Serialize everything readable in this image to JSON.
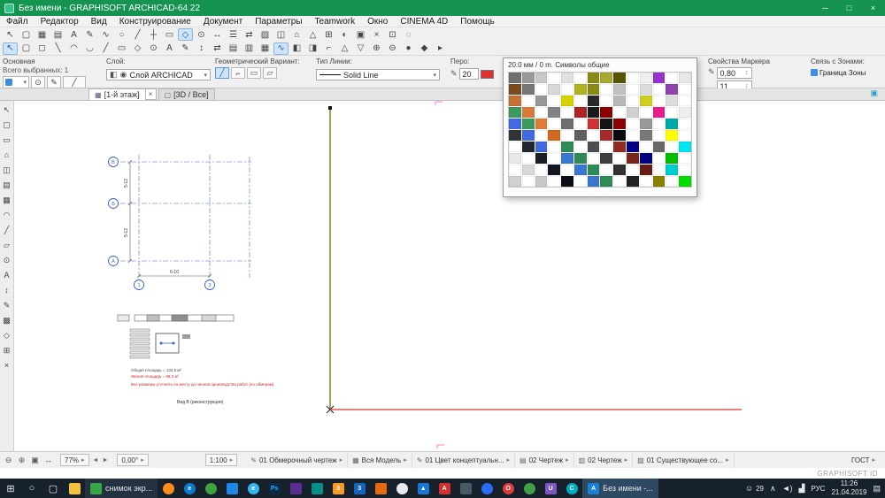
{
  "colors": {
    "titlebar_green": "#159351",
    "taskbar_dark": "#16212c",
    "pen_swatch_red": "#e03030",
    "construction_line_olive": "#77771e",
    "construction_line_red": "#e25555",
    "axis_blue": "#3a5fc0",
    "grid_dash_blue": "#7d96d8",
    "note_red": "#cc2222",
    "accent_blue": "#2f74c0"
  },
  "glyphs": {
    "caret_right": "▸",
    "caret_down": "▾",
    "stepper": "↕"
  },
  "window": {
    "title": "Без имени - GRAPHISOFT ARCHICAD-64 22",
    "controls": {
      "minimize": "─",
      "maximize": "□",
      "close": "×"
    }
  },
  "menu": {
    "items": [
      "Файл",
      "Редактор",
      "Вид",
      "Конструирование",
      "Документ",
      "Параметры",
      "Teamwork",
      "Окно",
      "CINEMA 4D",
      "Помощь"
    ]
  },
  "toolbar_row1": {
    "icons": [
      {
        "g": "↖"
      },
      {
        "g": "▢"
      },
      {
        "g": "▦"
      },
      {
        "g": "▤"
      },
      {
        "g": "A"
      },
      {
        "g": "✎"
      },
      {
        "g": "∿"
      },
      {
        "g": "○"
      },
      {
        "g": "╱"
      },
      {
        "g": "┼"
      },
      {
        "g": "▭"
      },
      {
        "g": "◇",
        "a": true
      },
      {
        "g": "⊙"
      },
      {
        "g": "↔"
      },
      {
        "g": "☰"
      },
      {
        "g": "⇄"
      },
      {
        "g": "▧"
      },
      {
        "g": "◫"
      },
      {
        "g": "⌂"
      },
      {
        "g": "△"
      },
      {
        "g": "⊞"
      },
      {
        "g": "◐"
      },
      {
        "g": "▣"
      },
      {
        "g": "×"
      },
      {
        "g": "⊡"
      },
      {
        "g": "◌"
      }
    ]
  },
  "toolbar_row2": {
    "icons": [
      {
        "g": "↖",
        "a": true
      },
      {
        "g": "▢"
      },
      {
        "g": "◻"
      },
      {
        "g": "╲"
      },
      {
        "g": "◠"
      },
      {
        "g": "◡"
      },
      {
        "g": "╱"
      },
      {
        "g": "▭"
      },
      {
        "g": "◇"
      },
      {
        "g": "⊙"
      },
      {
        "g": "A"
      },
      {
        "g": "✎"
      },
      {
        "g": "↕"
      },
      {
        "g": "⇄"
      },
      {
        "g": "▤"
      },
      {
        "g": "▥"
      },
      {
        "g": "▦"
      },
      {
        "g": "∿",
        "a": true
      },
      {
        "g": "◧"
      },
      {
        "g": "◨"
      },
      {
        "g": "⌐"
      },
      {
        "g": "△"
      },
      {
        "g": "▽"
      },
      {
        "g": "⊕"
      },
      {
        "g": "⊖"
      },
      {
        "g": "●"
      },
      {
        "g": "◆"
      },
      {
        "g": "▸"
      }
    ]
  },
  "info_bar": {
    "basic": {
      "title": "Основная",
      "count": "Всего выбранных: 1",
      "btn1": "⊙",
      "btn2": "✎",
      "btn3": "╱"
    },
    "layer": {
      "label": "Слой:",
      "lock_icon": "◧",
      "eye_icon": "◉",
      "value": "Слой ARCHICAD"
    },
    "geometry": {
      "label": "Геометрический Вариант:",
      "options": [
        {
          "g": "╱",
          "a": true
        },
        {
          "g": "⌐"
        },
        {
          "g": "▭"
        },
        {
          "g": "▱"
        }
      ]
    },
    "line_type": {
      "label": "Тип Линии:",
      "value": "Solid Line"
    },
    "pen": {
      "label": "Перо:",
      "icon": "✎",
      "value": "20",
      "swatch": "#e03030"
    },
    "marker": {
      "title": "Свойства Маркера",
      "icon": "✎",
      "field1": "0,80",
      "field2": "11"
    },
    "zone": {
      "title": "Связь с Зонами:",
      "value": "Граница Зоны"
    }
  },
  "tabs": {
    "items": [
      {
        "icon": "▦",
        "label": "[1-й этаж]"
      },
      {
        "icon": "▢",
        "label": "[3D / Все]"
      }
    ],
    "close_glyph": "×",
    "right_icon": "▣"
  },
  "left_palette": {
    "icons": [
      {
        "g": "↖"
      },
      {
        "g": "▢"
      },
      {
        "g": "▭"
      },
      {
        "g": "⌂"
      },
      {
        "g": "◫"
      },
      {
        "g": "▤"
      },
      {
        "g": "▦"
      },
      {
        "g": "◠"
      },
      {
        "g": "╱"
      },
      {
        "g": "▱"
      },
      {
        "g": "⊙"
      },
      {
        "g": "A"
      },
      {
        "g": "↕"
      },
      {
        "g": "✎"
      },
      {
        "g": "▩"
      },
      {
        "g": "◇"
      },
      {
        "g": "⊞"
      },
      {
        "g": "×"
      }
    ]
  },
  "pen_palette": {
    "title": "20.0 мм / 0 m. Символы общие",
    "colors": [
      "#707070",
      "#9a9a9a",
      "#c8c8c8",
      "#ffffff",
      "#e0e0e0",
      "#ffffff",
      "#8a8a1a",
      "#a8a832",
      "#565600",
      "#ffffff",
      "#efefef",
      "#9932cc",
      "#ffffff",
      "#e8e8e8",
      "#7b4a1e",
      "#777777",
      "#ffffff",
      "#d8d8d8",
      "#ffffff",
      "#b0b020",
      "#8a8a15",
      "#ffffff",
      "#c0c0c0",
      "#ffffff",
      "#dddddd",
      "#ffffff",
      "#8e44ad",
      "#ffffff",
      "#c87137",
      "#ffffff",
      "#989898",
      "#ffffff",
      "#d4d400",
      "#ffffff",
      "#2a2a2a",
      "#ffffff",
      "#b8b8b8",
      "#ffffff",
      "#cfcf20",
      "#ffffff",
      "#dddddd",
      "#ffffff",
      "#3a9a5c",
      "#d87b3a",
      "#ffffff",
      "#828282",
      "#ffffff",
      "#b22222",
      "#1a1a1a",
      "#8b0000",
      "#ffffff",
      "#d0d0d0",
      "#ffffff",
      "#e91e8c",
      "#ffffff",
      "#eeeeee",
      "#4169e1",
      "#3a9a5c",
      "#e07b39",
      "#ffffff",
      "#6e6e6e",
      "#ffffff",
      "#cd3333",
      "#141414",
      "#8b0000",
      "#ffffff",
      "#989898",
      "#ffffff",
      "#00a8a8",
      "#ffffff",
      "#30333a",
      "#4169e1",
      "#ffffff",
      "#d2691e",
      "#ffffff",
      "#5e5e5e",
      "#ffffff",
      "#a52a2a",
      "#0a0a0a",
      "#ffffff",
      "#787878",
      "#ffffff",
      "#ffff00",
      "#ffffff",
      "#ffffff",
      "#22262e",
      "#4169e1",
      "#ffffff",
      "#2e8b57",
      "#ffffff",
      "#4e4e4e",
      "#ffffff",
      "#922b21",
      "#000080",
      "#ffffff",
      "#686868",
      "#ffffff",
      "#00e5ee",
      "#e8e8e8",
      "#ffffff",
      "#1a1e26",
      "#ffffff",
      "#3a77d0",
      "#2e8b57",
      "#ffffff",
      "#3e3e3e",
      "#ffffff",
      "#7b241c",
      "#000080",
      "#ffffff",
      "#00c000",
      "#ffffff",
      "#ffffff",
      "#d8d8d8",
      "#ffffff",
      "#12161e",
      "#ffffff",
      "#3a77d0",
      "#2e8b57",
      "#ffffff",
      "#303030",
      "#ffffff",
      "#641e16",
      "#ffffff",
      "#00cdcd",
      "#ffffff",
      "#d0d0d0",
      "#ffffff",
      "#c8c8c8",
      "#ffffff",
      "#0a0e16",
      "#ffffff",
      "#3a77d0",
      "#2e8b57",
      "#ffffff",
      "#222222",
      "#ffffff",
      "#8b8000",
      "#ffffff",
      "#00e000"
    ]
  },
  "drawing": {
    "axis_rows": [
      "В",
      "Б",
      "А"
    ],
    "axis_cols": [
      "1",
      "3"
    ],
    "dim_h": "6-10",
    "dim_v": [
      "5-12",
      "5-12"
    ],
    "notes": [
      "Общая площадь = 134,5 м²",
      "Жилая площадь = 98,2 м²",
      "Все размеры уточнять по месту до начала производства работ (по обмерам)"
    ],
    "caption": "Вид В (реконструкция)"
  },
  "status_bar": {
    "zoom_icons": [
      {
        "g": "⊖"
      },
      {
        "g": "⊕"
      },
      {
        "g": "▣"
      },
      {
        "g": "↔"
      }
    ],
    "zoom_percent": "77%",
    "nav_prev": "◄",
    "nav_next": "►",
    "angle": "0,00°",
    "scale": "1:100",
    "segments": [
      {
        "icon": "✎",
        "label": "01 Обмерочный чертеж"
      },
      {
        "icon": "▦",
        "label": "Вся Модель"
      },
      {
        "icon": "✎",
        "label": "01 Цвет концептуальн..."
      },
      {
        "icon": "▤",
        "label": "02 Чертеж"
      },
      {
        "icon": "▥",
        "label": "02 Чертеж"
      },
      {
        "icon": "▧",
        "label": "01 Существующее со..."
      }
    ],
    "standard": "ГОСТ"
  },
  "branding": {
    "label": "GRAPHISOFT ID"
  },
  "taskbar": {
    "start_glyph": "⊞",
    "search_glyph": "○",
    "taskview_glyph": "▢",
    "pinned1": [
      {
        "bg": "#f2c23e",
        "n": "file-explorer"
      }
    ],
    "task1": {
      "label": "снимок экр...",
      "icon": "#35a845"
    },
    "pinned2": [
      {
        "bg": "#ff8c1a",
        "r": true,
        "n": "firefox"
      },
      {
        "bg": "#0b7bd0",
        "g": "e",
        "r": true,
        "n": "edge"
      },
      {
        "bg": "#3ea23e",
        "r": true,
        "n": "chrome"
      },
      {
        "bg": "#1e88e5",
        "n": "app"
      },
      {
        "bg": "#35b8f0",
        "g": "e",
        "r": true,
        "n": "internet-explorer"
      },
      {
        "bg": "#0c2a44",
        "g": "Ps",
        "fg": "#31a8ff",
        "n": "photoshop"
      },
      {
        "bg": "#5c2d91",
        "n": "app"
      },
      {
        "bg": "#0a8f86",
        "n": "app"
      },
      {
        "bg": "#f59a23",
        "g": "3",
        "n": "3ds-max"
      },
      {
        "bg": "#1565c0",
        "g": "3",
        "n": "app"
      },
      {
        "bg": "#e86a10",
        "n": "app"
      },
      {
        "bg": "#e8eaed",
        "fg": "#333",
        "r": true,
        "n": "app"
      },
      {
        "bg": "#1976d2",
        "g": "▲",
        "n": "app"
      },
      {
        "bg": "#d32f2f",
        "g": "A",
        "n": "acrobat"
      },
      {
        "bg": "#455a64",
        "n": "app"
      },
      {
        "bg": "#2a6df5",
        "r": true,
        "n": "app"
      },
      {
        "bg": "#e23b3b",
        "g": "O",
        "r": true,
        "n": "opera"
      },
      {
        "bg": "#43a047",
        "r": true,
        "n": "app"
      },
      {
        "bg": "#7e57c2",
        "g": "U",
        "n": "unity"
      },
      {
        "bg": "#00acc1",
        "g": "C",
        "r": true,
        "n": "app"
      }
    ],
    "task2": {
      "label": "Без имени -...",
      "icon": "#1b7fd4",
      "glyph": "A"
    },
    "tray": {
      "people": "☺",
      "badge": "29",
      "expand": "∧",
      "volume": "◄)",
      "network": "▟",
      "lang": "РУС",
      "time": "11:26",
      "date": "21.04.2019",
      "action": "▤"
    }
  }
}
